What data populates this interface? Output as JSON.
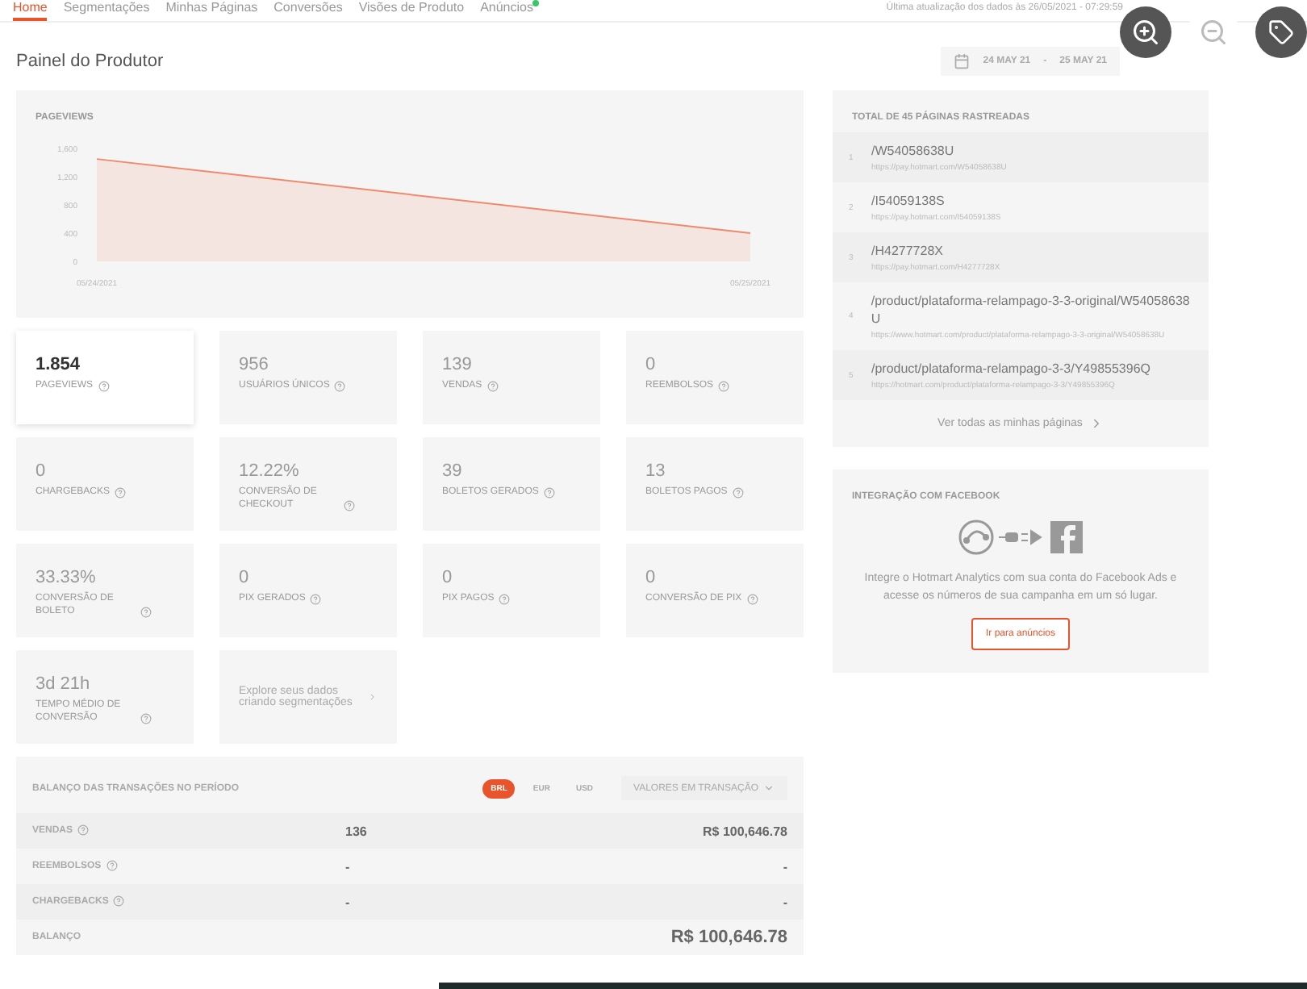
{
  "nav": {
    "tabs": [
      {
        "label": "Home",
        "selected": true,
        "badge": false
      },
      {
        "label": "Segmentações",
        "selected": false,
        "badge": false
      },
      {
        "label": "Minhas Páginas",
        "selected": false,
        "badge": false
      },
      {
        "label": "Conversões",
        "selected": false,
        "badge": false
      },
      {
        "label": "Visões de Produto",
        "selected": false,
        "badge": false
      },
      {
        "label": "Anúncios",
        "selected": false,
        "badge": true
      }
    ],
    "updated": "Última atualização dos dados às 26/05/2021 - 07:29:59"
  },
  "header": {
    "title": "Painel do Produtor",
    "date_from": "24 MAY 21",
    "date_separator": "-",
    "date_to": "25 MAY 21"
  },
  "pageviews_chart": {
    "title": "PAGEVIEWS",
    "chart_data": {
      "type": "area",
      "categories": [
        "05/24/2021",
        "05/25/2021"
      ],
      "series": [
        {
          "color": "#f08a6c",
          "values": [
            1450,
            400
          ]
        }
      ],
      "ylim": [
        0,
        1600
      ],
      "yticks": [
        0,
        400,
        800,
        {
          "value": 1200,
          "label": "1,200"
        },
        {
          "value": 1600,
          "label": "1,600"
        }
      ]
    }
  },
  "stats": [
    {
      "kind": "metric",
      "value": "1.854",
      "label": "PAGEVIEWS",
      "selected": true
    },
    {
      "kind": "metric",
      "value": "956",
      "label": "USUÁRIOS ÚNICOS",
      "selected": false
    },
    {
      "kind": "metric",
      "value": "139",
      "label": "VENDAS",
      "selected": false
    },
    {
      "kind": "metric",
      "value": "0",
      "label": "REEMBOLSOS",
      "selected": false
    },
    {
      "kind": "metric",
      "value": "0",
      "label": "CHARGEBACKS",
      "selected": false
    },
    {
      "kind": "metric",
      "value": "12.22%",
      "label": "CONVERSÃO DE CHECKOUT",
      "selected": false
    },
    {
      "kind": "metric",
      "value": "39",
      "label": "BOLETOS GERADOS",
      "selected": false
    },
    {
      "kind": "metric",
      "value": "13",
      "label": "BOLETOS PAGOS",
      "selected": false
    },
    {
      "kind": "metric",
      "value": "33.33%",
      "label": "CONVERSÃO DE BOLETO",
      "selected": false
    },
    {
      "kind": "metric",
      "value": "0",
      "label": "PIX GERADOS",
      "selected": false
    },
    {
      "kind": "metric",
      "value": "0",
      "label": "PIX PAGOS",
      "selected": false
    },
    {
      "kind": "metric",
      "value": "0",
      "label": "CONVERSÃO DE PIX",
      "selected": false
    },
    {
      "kind": "metric",
      "value": "3d 21h",
      "label": "TEMPO MÉDIO DE CONVERSÃO",
      "selected": false
    },
    {
      "kind": "link",
      "label": "Explore seus dados criando segmentações"
    }
  ],
  "balance": {
    "title": "BALANÇO DAS TRANSAÇÕES NO PERÍODO",
    "currencies": [
      {
        "label": "BRL",
        "selected": true
      },
      {
        "label": "EUR",
        "selected": false
      },
      {
        "label": "USD",
        "selected": false
      }
    ],
    "dropdown": "VALORES EM TRANSAÇÃO",
    "rows": [
      {
        "label": "VENDAS",
        "help": true,
        "count": "136",
        "amount": "R$ 100,646.78",
        "total": false
      },
      {
        "label": "REEMBOLSOS",
        "help": true,
        "count": "-",
        "amount": "-",
        "total": false
      },
      {
        "label": "CHARGEBACKS",
        "help": true,
        "count": "-",
        "amount": "-",
        "total": false
      },
      {
        "label": "BALANÇO",
        "help": false,
        "count": "",
        "amount": "R$ 100,646.78",
        "total": true
      }
    ]
  },
  "pages": {
    "title": "TOTAL DE 45 PÁGINAS RASTREADAS",
    "items": [
      {
        "index": "1",
        "path": "/W54058638U",
        "url": "https://pay.hotmart.com/W54058638U"
      },
      {
        "index": "2",
        "path": "/I54059138S",
        "url": "https://pay.hotmart.com/I54059138S"
      },
      {
        "index": "3",
        "path": "/H4277728X",
        "url": "https://pay.hotmart.com/H4277728X"
      },
      {
        "index": "4",
        "path": "/product/plataforma-relampago-3-3-original/W54058638U",
        "url": "https://www.hotmart.com/product/plataforma-relampago-3-3-original/W54058638U"
      },
      {
        "index": "5",
        "path": "/product/plataforma-relampago-3-3/Y49855396Q",
        "url": "https://hotmart.com/product/plataforma-relampago-3-3/Y49855396Q"
      }
    ],
    "more": "Ver todas as minhas páginas"
  },
  "facebook": {
    "title": "INTEGRAÇÃO COM FACEBOOK",
    "text": "Integre o Hotmart Analytics com sua conta do Facebook Ads e acesse os números de sua campanha em um só lugar.",
    "button": "Ir para anúncios"
  }
}
